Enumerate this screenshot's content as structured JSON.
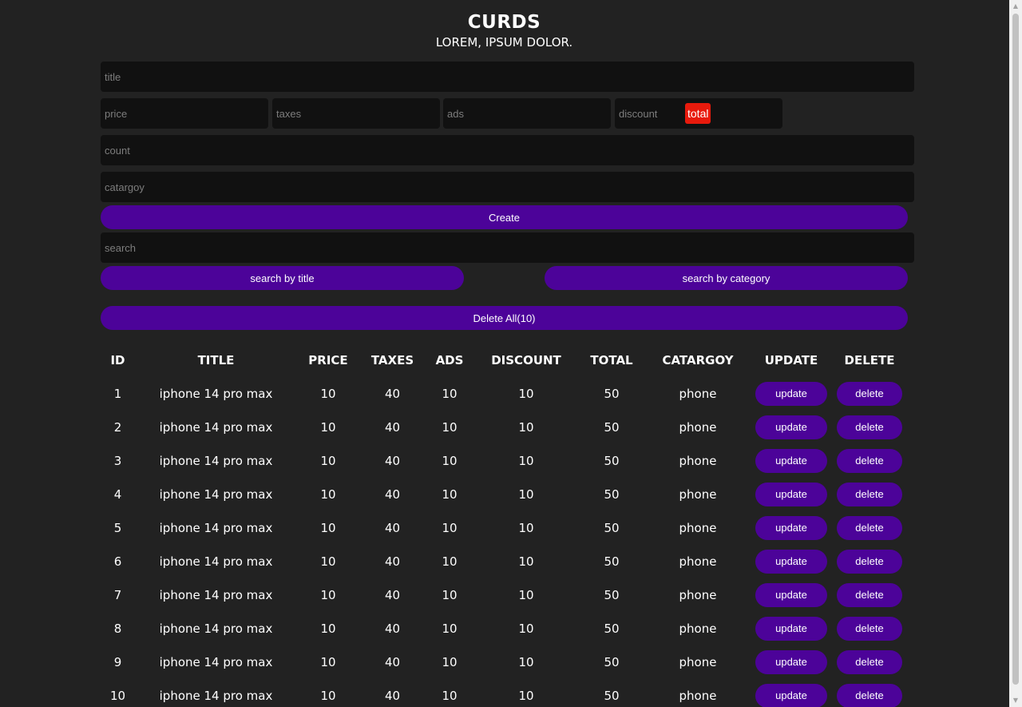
{
  "header": {
    "title": "CURDS",
    "subtitle": "LOREM, IPSUM DOLOR."
  },
  "form": {
    "title_placeholder": "title",
    "price_placeholder": "price",
    "taxes_placeholder": "taxes",
    "ads_placeholder": "ads",
    "discount_placeholder": "discount",
    "total_label": "total",
    "count_placeholder": "count",
    "category_placeholder": "catargoy",
    "create_label": "Create"
  },
  "search": {
    "placeholder": "search",
    "by_title_label": "search by title",
    "by_category_label": "search by category"
  },
  "delete_all_label": "Delete All(10)",
  "table": {
    "headers": [
      "ID",
      "TITLE",
      "PRICE",
      "TAXES",
      "ADS",
      "DISCOUNT",
      "TOTAL",
      "CATARGOY",
      "UPDATE",
      "DELETE"
    ],
    "update_label": "update",
    "delete_label": "delete",
    "rows": [
      {
        "id": "1",
        "title": "iphone 14 pro max",
        "price": "10",
        "taxes": "40",
        "ads": "10",
        "discount": "10",
        "total": "50",
        "category": "phone"
      },
      {
        "id": "2",
        "title": "iphone 14 pro max",
        "price": "10",
        "taxes": "40",
        "ads": "10",
        "discount": "10",
        "total": "50",
        "category": "phone"
      },
      {
        "id": "3",
        "title": "iphone 14 pro max",
        "price": "10",
        "taxes": "40",
        "ads": "10",
        "discount": "10",
        "total": "50",
        "category": "phone"
      },
      {
        "id": "4",
        "title": "iphone 14 pro max",
        "price": "10",
        "taxes": "40",
        "ads": "10",
        "discount": "10",
        "total": "50",
        "category": "phone"
      },
      {
        "id": "5",
        "title": "iphone 14 pro max",
        "price": "10",
        "taxes": "40",
        "ads": "10",
        "discount": "10",
        "total": "50",
        "category": "phone"
      },
      {
        "id": "6",
        "title": "iphone 14 pro max",
        "price": "10",
        "taxes": "40",
        "ads": "10",
        "discount": "10",
        "total": "50",
        "category": "phone"
      },
      {
        "id": "7",
        "title": "iphone 14 pro max",
        "price": "10",
        "taxes": "40",
        "ads": "10",
        "discount": "10",
        "total": "50",
        "category": "phone"
      },
      {
        "id": "8",
        "title": "iphone 14 pro max",
        "price": "10",
        "taxes": "40",
        "ads": "10",
        "discount": "10",
        "total": "50",
        "category": "phone"
      },
      {
        "id": "9",
        "title": "iphone 14 pro max",
        "price": "10",
        "taxes": "40",
        "ads": "10",
        "discount": "10",
        "total": "50",
        "category": "phone"
      },
      {
        "id": "10",
        "title": "iphone 14 pro max",
        "price": "10",
        "taxes": "40",
        "ads": "10",
        "discount": "10",
        "total": "50",
        "category": "phone"
      }
    ]
  },
  "colors": {
    "background": "#222222",
    "input_bg": "#111111",
    "accent": "#4c0399",
    "total_badge": "#e81a0c"
  }
}
